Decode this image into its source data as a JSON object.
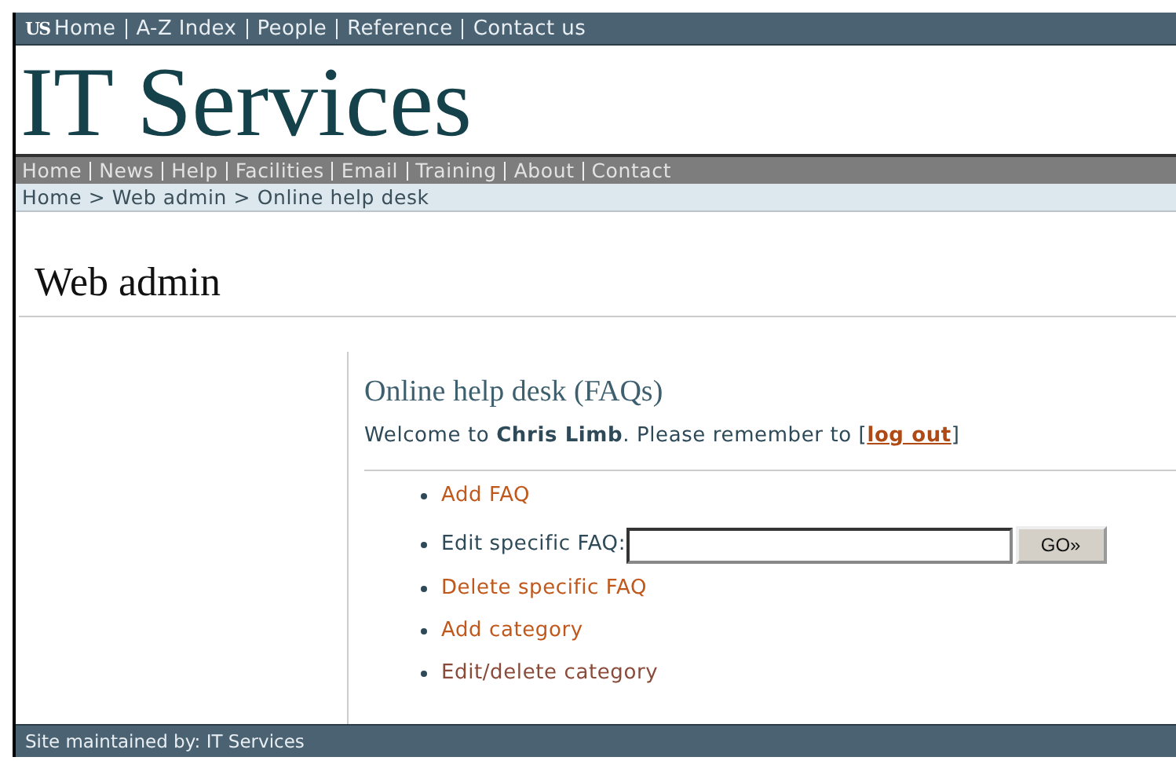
{
  "top_bar": {
    "logo": "US",
    "links": [
      "Home",
      "A-Z Index",
      "People",
      "Reference",
      "Contact us"
    ]
  },
  "site_title": "IT Services",
  "nav": [
    "Home",
    "News",
    "Help",
    "Facilities",
    "Email",
    "Training",
    "About",
    "Contact"
  ],
  "breadcrumb": "Home > Web admin > Online help desk",
  "page_title": "Web admin",
  "panel": {
    "heading": "Online help desk (FAQs)",
    "welcome": "Welcome to **Chris Limb**. Please remember to [",
    "logout": "log out",
    "welcome_end": "]",
    "items": [
      {
        "kind": "link",
        "label": "Add FAQ",
        "visited": false
      },
      {
        "kind": "field",
        "label": "Edit specific FAQ:",
        "button": "GO»"
      },
      {
        "kind": "link",
        "label": "Delete specific FAQ",
        "visited": false
      },
      {
        "kind": "link",
        "label": "Add category",
        "visited": false
      },
      {
        "kind": "link",
        "label": "Edit/delete category",
        "visited": true
      }
    ]
  },
  "footer": "Site maintained by: IT Services"
}
